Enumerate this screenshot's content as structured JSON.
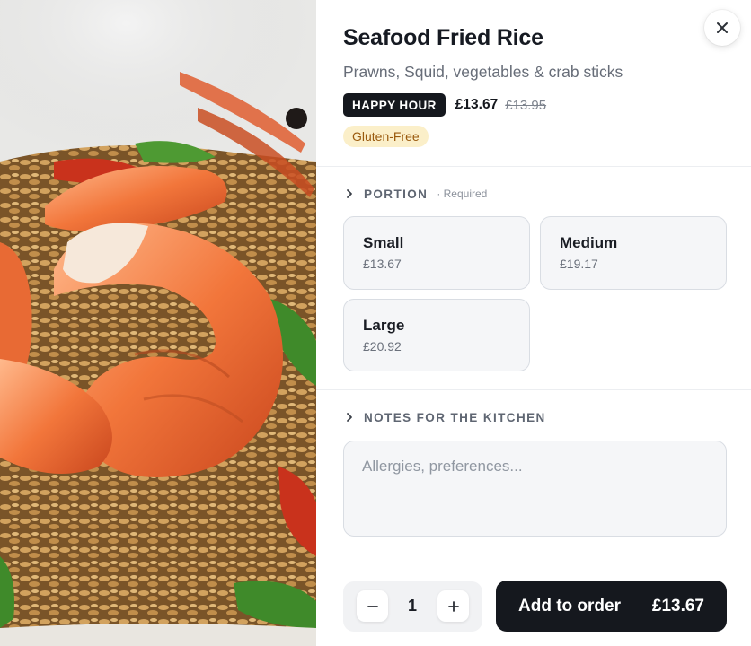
{
  "dish": {
    "image_alt": "Seafood fried rice with prawns",
    "title": "Seafood Fried Rice",
    "description": "Prawns, Squid, vegetables & crab sticks",
    "promo_badge": "HAPPY HOUR",
    "price_current": "£13.67",
    "price_original": "£13.95",
    "dietary_tag": "Gluten-Free"
  },
  "close": {
    "icon": "close-icon"
  },
  "portion": {
    "title": "PORTION",
    "note": "· Required",
    "options": [
      {
        "name": "Small",
        "price": "£13.67"
      },
      {
        "name": "Medium",
        "price": "£19.17"
      },
      {
        "name": "Large",
        "price": "£20.92"
      }
    ]
  },
  "notes": {
    "title": "NOTES FOR THE KITCHEN",
    "placeholder": "Allergies, preferences...",
    "value": ""
  },
  "quantity": {
    "value": "1",
    "decrease_icon": "minus-icon",
    "increase_icon": "plus-icon"
  },
  "add_to_order": {
    "label": "Add to order",
    "total": "£13.67"
  },
  "colors": {
    "primary_dark": "#15181e",
    "badge_yellow_bg": "#fbefc9",
    "badge_yellow_text": "#9a5a0e",
    "card_border": "#d9dde3",
    "card_bg": "#f5f6f8"
  }
}
